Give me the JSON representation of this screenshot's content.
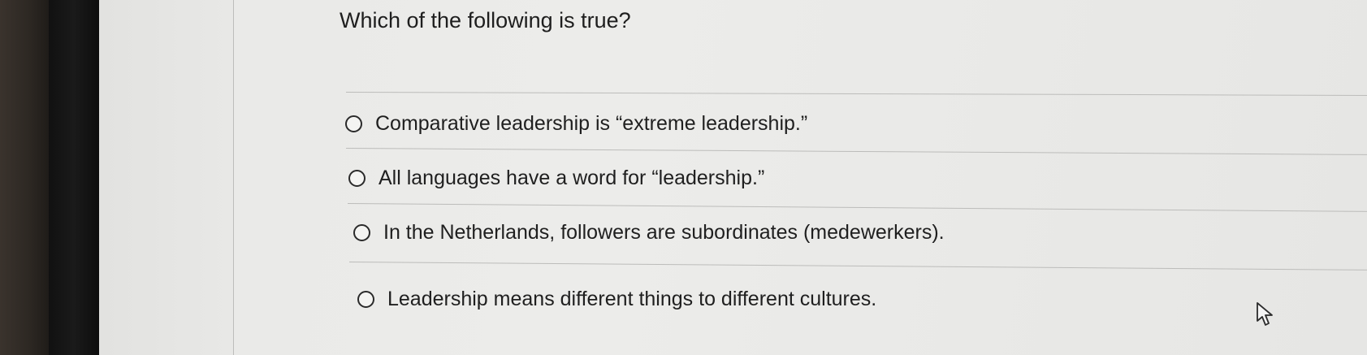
{
  "question": {
    "text": "Which of the following is true?"
  },
  "options": [
    {
      "label": "Comparative leadership is “extreme leadership.”"
    },
    {
      "label": "All languages have a word for “leadership.”"
    },
    {
      "label": "In the Netherlands, followers are subordinates (medewerkers)."
    },
    {
      "label": "Leadership means different things to different cultures."
    }
  ],
  "icons": {
    "radio": "radio-unselected-icon",
    "cursor": "pointer-cursor-icon"
  },
  "colors": {
    "screen_bg": "#ececea",
    "text": "#1e1e1e",
    "bezel": "#111111"
  }
}
